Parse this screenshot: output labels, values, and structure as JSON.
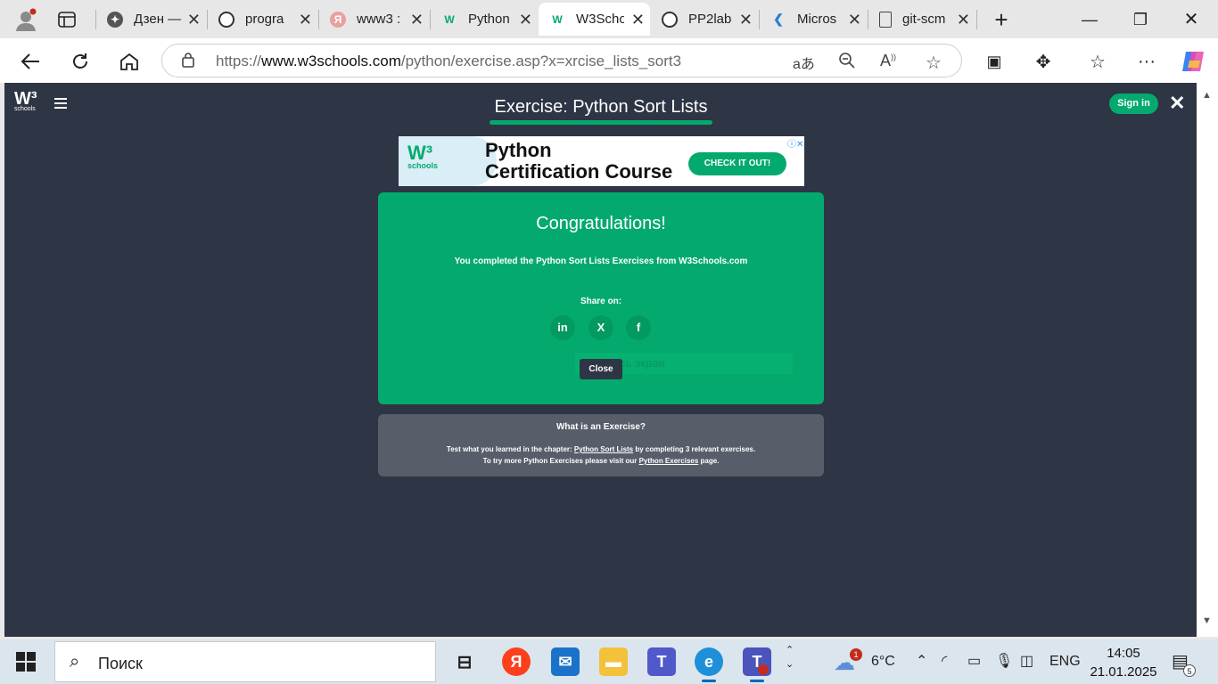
{
  "browser": {
    "tabs": [
      {
        "label": "Дзен —",
        "icon": "sparkle-icon"
      },
      {
        "label": "progra",
        "icon": "github-icon"
      },
      {
        "label": "www3 :",
        "icon": "yandex-icon"
      },
      {
        "label": "Python",
        "icon": "w3schools-icon"
      },
      {
        "label": "W3Scho",
        "icon": "w3schools-icon",
        "active": true
      },
      {
        "label": "PP2lab",
        "icon": "github-icon"
      },
      {
        "label": "Micros",
        "icon": "vscode-icon"
      },
      {
        "label": "git-scm",
        "icon": "page-icon"
      }
    ],
    "new_tab": "+",
    "url_prefix": "https://",
    "url_domain": "www.w3schools.com",
    "url_path": "/python/exercise.asp?x=xrcise_lists_sort3"
  },
  "page": {
    "logo_main": "W³",
    "logo_sub": "schools",
    "exercise_title": "Exercise: Python Sort Lists",
    "sign_in": "Sign in",
    "close_symbol": "✕"
  },
  "ad": {
    "logo_main": "W³",
    "logo_sub": "schools",
    "line1": "Python",
    "line2": "Certification Course",
    "button": "CHECK IT OUT!"
  },
  "congrats": {
    "title": "Congratulations!",
    "message": "You completed the Python Sort Lists Exercises from W3Schools.com",
    "share_label": "Share on:",
    "share_buttons": [
      "in",
      "X",
      "f"
    ],
    "ghost_text": "Весь экран",
    "close_button": "Close"
  },
  "what_is": {
    "title": "What is an Exercise?",
    "line1_pre": "Test what you learned in the chapter: ",
    "line1_link": "Python Sort Lists",
    "line1_post": " by completing 3 relevant exercises.",
    "line2_pre": "To try more Python Exercises please visit our ",
    "line2_link": "Python Exercises",
    "line2_post": " page."
  },
  "taskbar": {
    "search_placeholder": "Поиск",
    "weather_temp": "6°C",
    "weather_badge": "1",
    "language": "ENG",
    "time": "14:05",
    "date": "21.01.2025",
    "notification_count": "5"
  }
}
